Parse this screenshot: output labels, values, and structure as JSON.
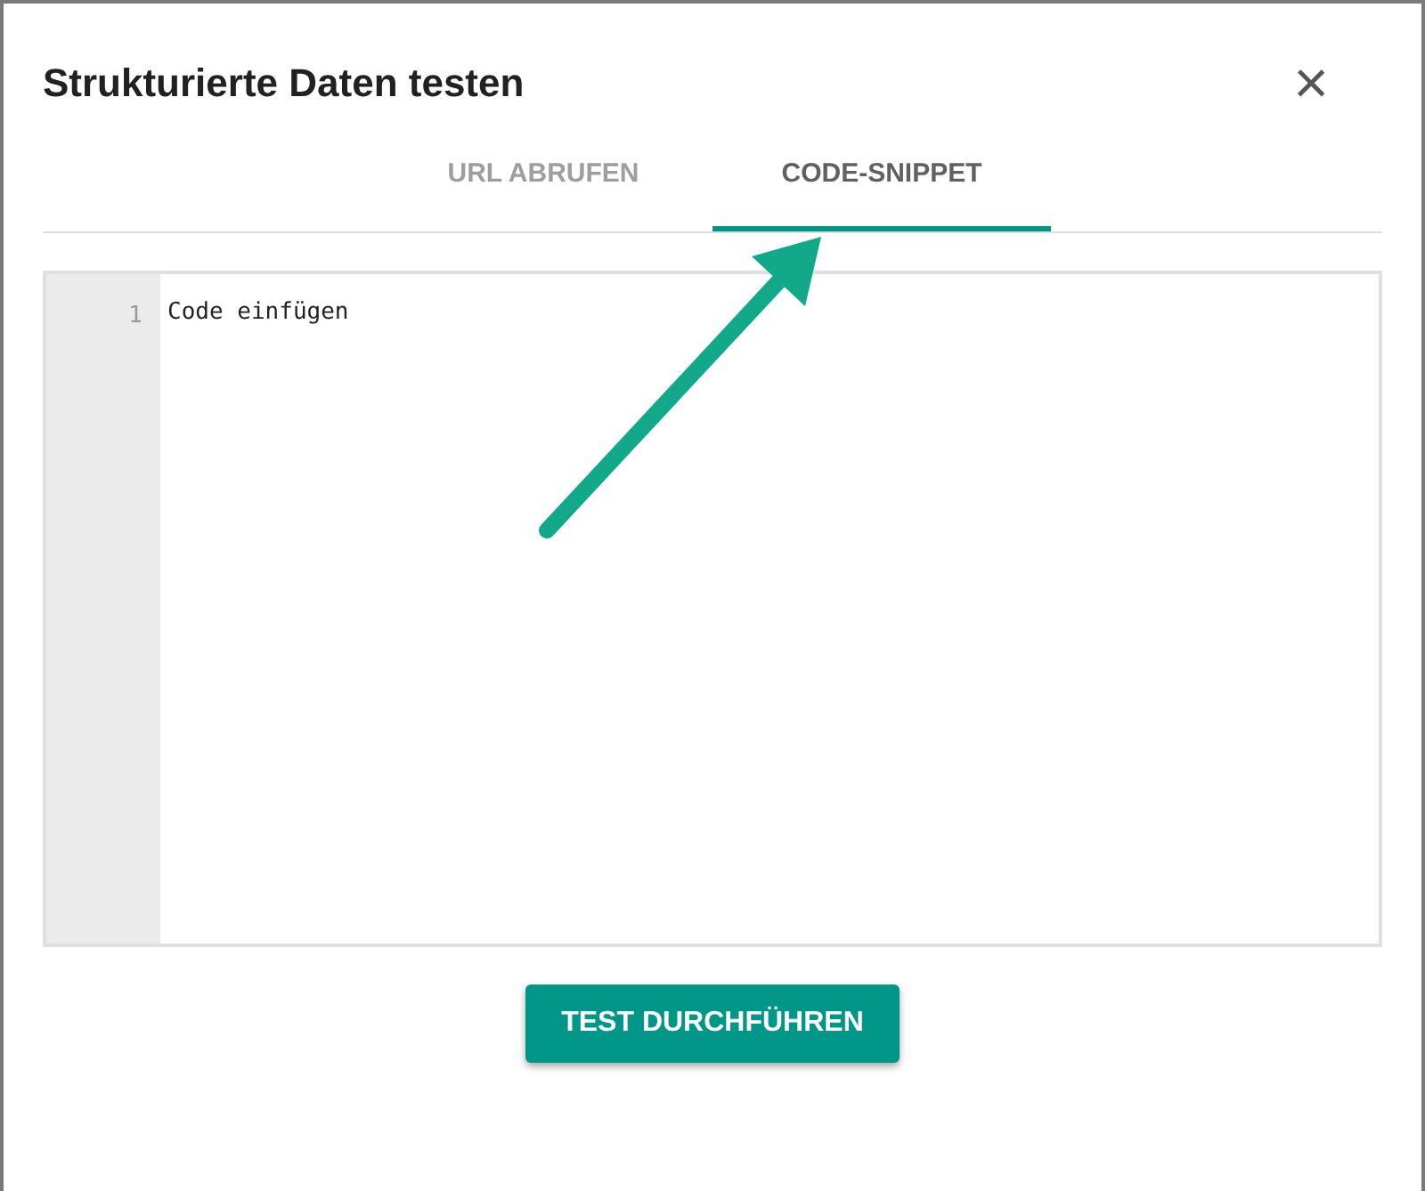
{
  "dialog": {
    "title": "Strukturierte Daten testen",
    "close": "×"
  },
  "tabs": [
    {
      "label": "URL ABRUFEN",
      "selected": false
    },
    {
      "label": "CODE-SNIPPET",
      "selected": true
    }
  ],
  "editor": {
    "line_numbers": [
      "1"
    ],
    "placeholder": "Code einfügen"
  },
  "button": "TEST DURCHFÜHREN"
}
